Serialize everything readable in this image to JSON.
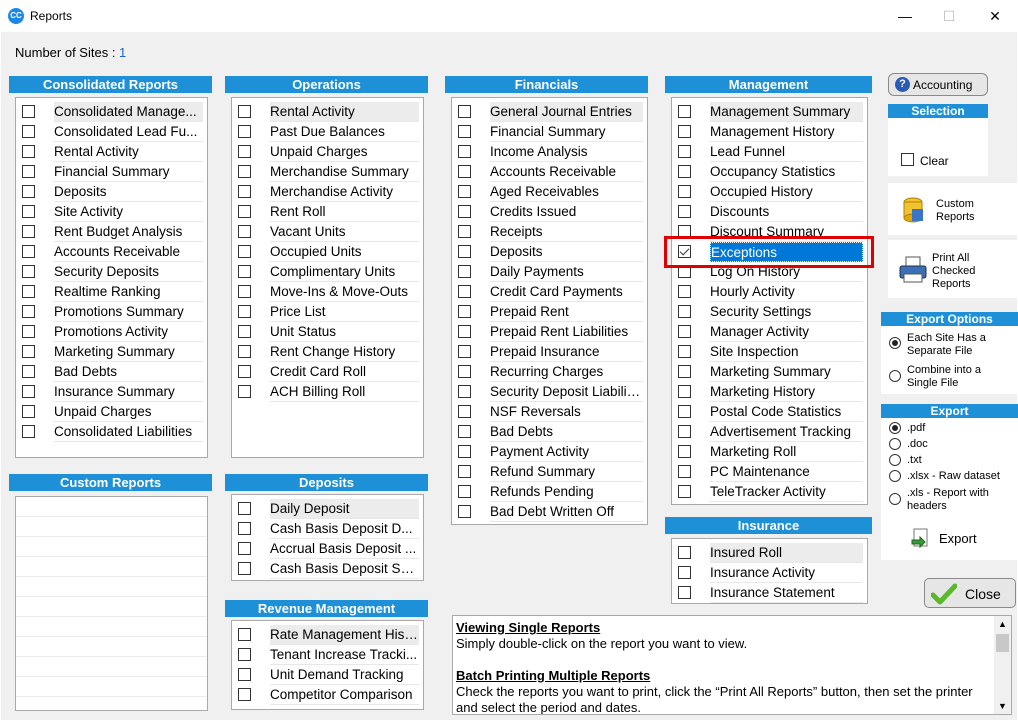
{
  "window": {
    "title": "Reports",
    "app_icon": "CC",
    "minimize": "—",
    "maximize": "☐",
    "close": "✕"
  },
  "sites": {
    "label": "Number of Sites : ",
    "count": "1"
  },
  "consolidated": {
    "title": "Consolidated Reports",
    "items": [
      "Consolidated Manage...",
      "Consolidated Lead Fu...",
      "Rental Activity",
      "Financial Summary",
      "Deposits",
      "Site Activity",
      "Rent Budget Analysis",
      "Accounts Receivable",
      "Security Deposits",
      "Realtime Ranking",
      "Promotions Summary",
      "Promotions Activity",
      "Marketing Summary",
      "Bad Debts",
      "Insurance Summary",
      "Unpaid Charges",
      "Consolidated Liabilities"
    ]
  },
  "custom": {
    "title": "Custom Reports"
  },
  "operations": {
    "title": "Operations",
    "items": [
      "Rental Activity",
      "Past Due Balances",
      "Unpaid Charges",
      "Merchandise Summary",
      "Merchandise Activity",
      "Rent Roll",
      "Vacant Units",
      "Occupied Units",
      "Complimentary Units",
      "Move-Ins & Move-Outs",
      "Price List",
      "Unit Status",
      "Rent Change History",
      "Credit Card Roll",
      "ACH Billing Roll"
    ]
  },
  "deposits": {
    "title": "Deposits",
    "items": [
      "Daily Deposit",
      "Cash Basis Deposit D...",
      "Accrual Basis Deposit ...",
      "Cash Basis Deposit Su..."
    ]
  },
  "revenue": {
    "title": "Revenue Management",
    "items": [
      "Rate Management Hist...",
      "Tenant Increase Tracki...",
      "Unit Demand Tracking",
      "Competitor Comparison"
    ]
  },
  "financials": {
    "title": "Financials",
    "items": [
      "General Journal Entries",
      "Financial Summary",
      "Income Analysis",
      "Accounts Receivable",
      "Aged Receivables",
      "Credits Issued",
      "Receipts",
      "Deposits",
      "Daily Payments",
      "Credit Card Payments",
      "Prepaid Rent",
      "Prepaid Rent Liabilities",
      "Prepaid Insurance",
      "Recurring Charges",
      "Security Deposit Liabiliti...",
      "NSF Reversals",
      "Bad Debts",
      "Payment Activity",
      "Refund Summary",
      "Refunds Pending",
      "Bad Debt Written Off"
    ]
  },
  "management": {
    "title": "Management",
    "items": [
      "Management Summary",
      "Management History",
      "Lead Funnel",
      "Occupancy Statistics",
      "Occupied History",
      "Discounts",
      "Discount Summary",
      "Exceptions",
      "Log On History",
      "Hourly Activity",
      "Security Settings",
      "Manager Activity",
      "Site Inspection",
      "Marketing Summary",
      "Marketing History",
      "Postal Code Statistics",
      "Advertisement Tracking",
      "Marketing Roll",
      "PC Maintenance",
      "TeleTracker Activity"
    ],
    "selected_index": 7
  },
  "insurance": {
    "title": "Insurance",
    "items": [
      "Insured Roll",
      "Insurance Activity",
      "Insurance Statement"
    ]
  },
  "side": {
    "accounting_label": "Accounting",
    "selection_title": "Selection",
    "clear_label": "Clear",
    "custom_reports_label": "Custom Reports",
    "print_all_label": "Print All Checked Reports",
    "export_options_title": "Export Options",
    "opt_each": "Each Site Has a Separate File",
    "opt_single": "Combine into a Single File",
    "export_title": "Export",
    "formats": [
      ".pdf",
      ".doc",
      ".txt",
      ".xlsx - Raw dataset",
      ".xls - Report with headers"
    ],
    "export_label": "Export",
    "close_label": "Close"
  },
  "help": {
    "h1": "Viewing Single Reports",
    "p1": "Simply double-click on the report you want to view.",
    "h2": "Batch Printing Multiple Reports",
    "p2": "Check the reports you want to print, click the “Print All Reports” button, then set the printer and select the period and dates."
  }
}
